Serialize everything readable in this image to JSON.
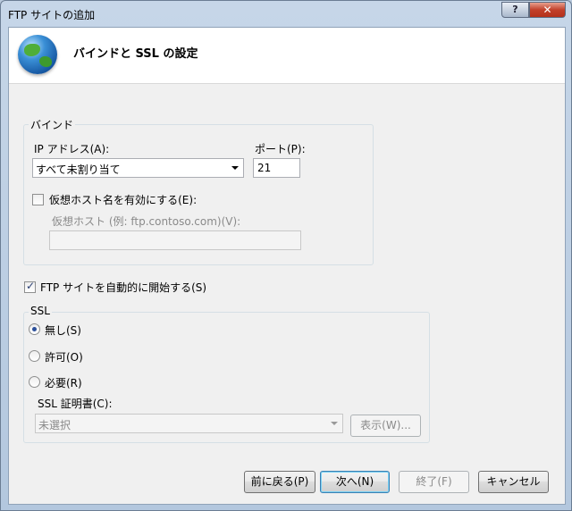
{
  "window": {
    "title": "FTP サイトの追加",
    "help_label": "?",
    "close_label": "✕"
  },
  "header": {
    "title": "バインドと SSL の設定",
    "icon": "globe-icon"
  },
  "binding": {
    "legend": "バインド",
    "ip_label": "IP アドレス(A):",
    "ip_value": "すべて未割り当て",
    "port_label": "ポート(P):",
    "port_value": "21",
    "vhost_checkbox_label": "仮想ホスト名を有効にする(E):",
    "vhost_checked": false,
    "vhost_label": "仮想ホスト (例: ftp.contoso.com)(V):",
    "vhost_value": ""
  },
  "autostart": {
    "label": "FTP サイトを自動的に開始する(S)",
    "checked": true
  },
  "ssl": {
    "legend": "SSL",
    "options": [
      {
        "label": "無し(S)",
        "selected": true
      },
      {
        "label": "許可(O)",
        "selected": false
      },
      {
        "label": "必要(R)",
        "selected": false
      }
    ],
    "cert_label": "SSL 証明書(C):",
    "cert_value": "未選択",
    "view_button": "表示(W)..."
  },
  "footer": {
    "back": "前に戻る(P)",
    "next": "次へ(N)",
    "finish": "終了(F)",
    "cancel": "キャンセル"
  }
}
